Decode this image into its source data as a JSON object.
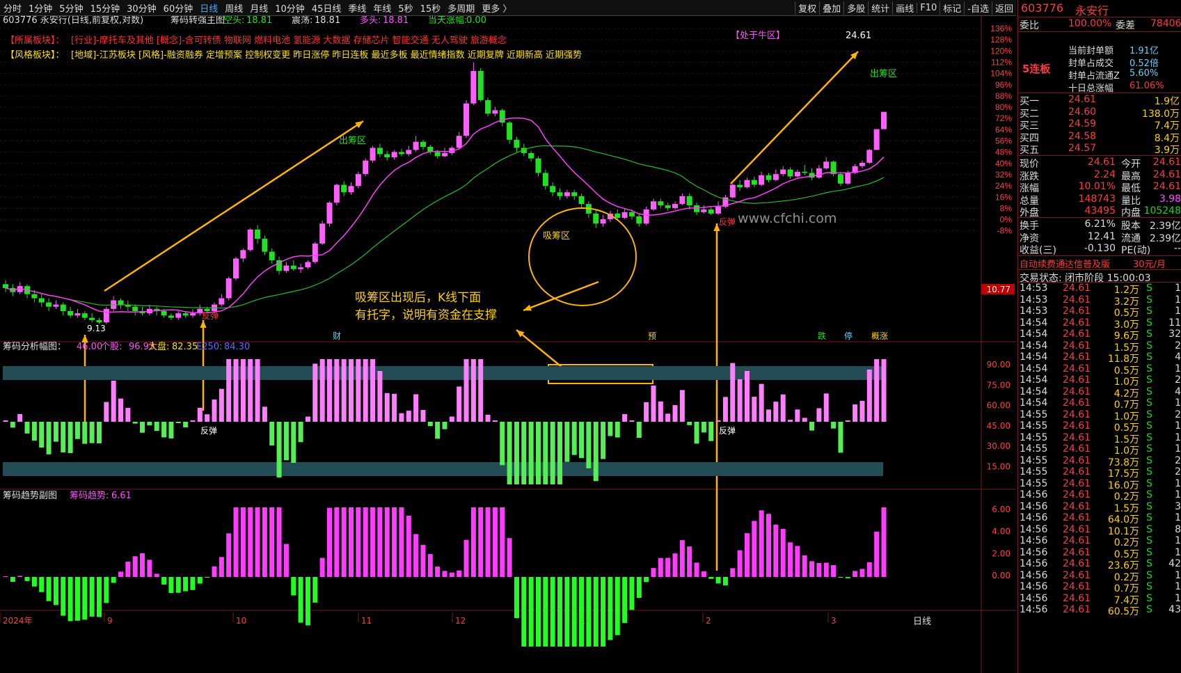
{
  "toolbar": {
    "periods": [
      "分时",
      "1分钟",
      "5分钟",
      "15分钟",
      "30分钟",
      "60分钟",
      "日线",
      "周线",
      "月线",
      "10分钟",
      "45日线",
      "季线",
      "年线",
      "5秒",
      "15秒",
      "多周期",
      "更多 〉"
    ],
    "active": "日线",
    "right": [
      "复权",
      "叠加",
      "多股",
      "统计",
      "画线",
      "F10",
      "标记",
      "-自选",
      "返回"
    ]
  },
  "chart_data": {
    "type": "candlestick",
    "x_labels": [
      "2024年",
      "9",
      "10",
      "11",
      "12",
      "1",
      "2",
      "3"
    ],
    "price_axis": [
      "136%",
      "128%",
      "120%",
      "112%",
      "104%",
      "96%",
      "88%",
      "80%",
      "72%",
      "64%",
      "56%",
      "48%",
      "40%",
      "32%",
      "24%",
      "16%",
      "8%",
      "0%",
      "-8%"
    ],
    "price_axis_tag": "10.77",
    "cost_axis": [
      "90.00",
      "75.00",
      "60.00",
      "45.00",
      "30.00",
      "15.00"
    ],
    "trend_axis": [
      "6.00",
      "4.00",
      "2.00",
      "0.00"
    ],
    "high_label": "24.61",
    "low_label": "9.13",
    "top_info": {
      "code": "603776 永安行(日线,前复权,对数)",
      "indicator": "筹码转强主图",
      "short_label": "空头:",
      "short_val": "18.81",
      "osc_label": "震荡:",
      "osc_val": "18.81",
      "long_label": "多头:",
      "long_val": "18.81",
      "chg_label": "当天涨幅:",
      "chg_val": "0.00"
    },
    "sector1": "【所属板块】：",
    "sector1_text": "[行业]-摩托车及其他 [概念]-含可转债 物联网 燃料电池 氢能源 大数据 存储芯片 智能交通 无人驾驶 旅游概念",
    "sector2": "【风格板块】：",
    "sector2_text": "[地域]-江苏板块 [风格]-融资融券 定增预案 控制权变更 昨日涨停 昨日连板 最近多板 最近情绪指数 近期复牌 近期新高 近期强势",
    "sub1": {
      "name": "筹码分析幅图：",
      "v1": "46.00",
      "v2l": "个股:",
      "v2": "96.93",
      "v3l": "大盘:",
      "v3": "82.35",
      "v4l": "E250:",
      "v4": "84.30"
    },
    "sub2": {
      "name": "筹码趋势副图",
      "v1l": "筹码趋势:",
      "v1": "6.61"
    },
    "annotations": {
      "chu1": "出筹区",
      "chu2": "出筹区",
      "xi": "吸筹区",
      "niu": "【处于牛区】",
      "fan1": "反弹",
      "fan2": "反弹",
      "fan3": "反弹",
      "fan4": "反弹",
      "cai": "财",
      "yu": "预",
      "die": "跌",
      "ting": "停",
      "gai": "概涨",
      "note1": "吸筹区出现后，K线下面",
      "note2": "有托字，说明有资金在支撑",
      "watermark": "www.cfchi.com",
      "bottom": "日线"
    },
    "candles": [
      [
        11.0,
        10.8,
        11.2,
        10.6
      ],
      [
        10.8,
        10.6,
        11.0,
        10.4
      ],
      [
        10.6,
        10.9,
        11.1,
        10.5
      ],
      [
        10.9,
        10.5,
        11.0,
        10.3
      ],
      [
        10.5,
        10.3,
        10.7,
        10.1
      ],
      [
        10.3,
        10.1,
        10.5,
        9.9
      ],
      [
        10.1,
        9.9,
        10.3,
        9.7
      ],
      [
        9.9,
        10.0,
        10.2,
        9.8
      ],
      [
        10.0,
        9.7,
        10.1,
        9.5
      ],
      [
        9.7,
        9.5,
        9.9,
        9.4
      ],
      [
        9.5,
        9.6,
        9.8,
        9.4
      ],
      [
        9.6,
        9.4,
        9.7,
        9.3
      ],
      [
        9.4,
        9.3,
        9.6,
        9.2
      ],
      [
        9.3,
        9.2,
        9.4,
        9.13
      ],
      [
        9.2,
        9.8,
        9.9,
        9.13
      ],
      [
        9.8,
        10.2,
        10.4,
        9.7
      ],
      [
        10.2,
        10.0,
        10.3,
        9.8
      ],
      [
        10.0,
        9.9,
        10.2,
        9.7
      ],
      [
        9.9,
        9.7,
        10.0,
        9.5
      ],
      [
        9.7,
        9.6,
        9.9,
        9.5
      ],
      [
        9.6,
        9.8,
        10.0,
        9.5
      ],
      [
        9.8,
        9.7,
        9.9,
        9.5
      ],
      [
        9.7,
        9.5,
        9.8,
        9.4
      ],
      [
        9.5,
        9.4,
        9.6,
        9.3
      ],
      [
        9.4,
        9.6,
        9.7,
        9.3
      ],
      [
        9.6,
        9.5,
        9.7,
        9.4
      ],
      [
        9.5,
        9.6,
        9.8,
        9.4
      ],
      [
        9.6,
        9.8,
        10.0,
        9.5
      ],
      [
        9.8,
        9.7,
        9.9,
        9.6
      ],
      [
        9.7,
        10.0,
        10.1,
        9.6
      ],
      [
        10.0,
        10.3,
        10.5,
        9.9
      ],
      [
        10.3,
        11.3,
        11.4,
        10.2
      ],
      [
        11.3,
        12.4,
        12.5,
        11.2
      ],
      [
        12.4,
        12.9,
        13.0,
        12.2
      ],
      [
        12.9,
        14.2,
        14.3,
        12.8
      ],
      [
        14.2,
        13.6,
        14.5,
        13.3
      ],
      [
        13.6,
        12.8,
        13.8,
        12.6
      ],
      [
        12.8,
        12.3,
        13.0,
        12.1
      ],
      [
        12.3,
        11.7,
        12.5,
        11.5
      ],
      [
        11.7,
        12.0,
        12.2,
        11.6
      ],
      [
        12.0,
        11.8,
        12.3,
        11.7
      ],
      [
        11.8,
        11.9,
        12.1,
        11.6
      ],
      [
        11.9,
        12.2,
        12.3,
        11.8
      ],
      [
        12.2,
        13.3,
        13.4,
        12.1
      ],
      [
        13.3,
        14.6,
        14.8,
        13.2
      ],
      [
        14.6,
        16.1,
        16.2,
        14.4
      ],
      [
        16.1,
        17.5,
        17.6,
        15.9
      ],
      [
        17.5,
        16.9,
        17.8,
        16.6
      ],
      [
        16.9,
        17.4,
        17.7,
        16.7
      ],
      [
        17.4,
        18.4,
        18.6,
        17.2
      ],
      [
        18.4,
        19.6,
        19.8,
        18.2
      ],
      [
        19.6,
        20.8,
        21.0,
        19.4
      ],
      [
        20.8,
        20.2,
        21.2,
        19.9
      ],
      [
        20.2,
        19.9,
        20.5,
        19.6
      ],
      [
        19.9,
        20.4,
        20.6,
        19.7
      ],
      [
        20.4,
        20.2,
        20.7,
        20.0
      ],
      [
        20.2,
        20.6,
        21.0,
        20.0
      ],
      [
        20.6,
        21.4,
        22.0,
        20.4
      ],
      [
        21.4,
        20.9,
        21.6,
        20.6
      ],
      [
        20.9,
        20.4,
        21.1,
        20.2
      ],
      [
        20.4,
        20.0,
        20.6,
        19.8
      ],
      [
        20.0,
        20.3,
        20.8,
        19.9
      ],
      [
        20.3,
        20.8,
        21.0,
        20.1
      ],
      [
        20.8,
        22.0,
        22.4,
        20.7
      ],
      [
        22.0,
        25.6,
        26.0,
        21.8
      ],
      [
        25.6,
        29.8,
        31.0,
        25.4
      ],
      [
        29.8,
        26.0,
        30.2,
        25.8
      ],
      [
        26.0,
        24.4,
        26.3,
        24.1
      ],
      [
        24.4,
        24.8,
        25.2,
        24.1
      ],
      [
        24.8,
        23.4,
        25.0,
        23.0
      ],
      [
        23.4,
        21.6,
        23.6,
        21.2
      ],
      [
        21.6,
        20.8,
        21.9,
        20.4
      ],
      [
        20.8,
        20.3,
        21.2,
        20.0
      ],
      [
        20.3,
        19.8,
        20.5,
        19.5
      ],
      [
        19.8,
        18.5,
        20.0,
        18.2
      ],
      [
        18.5,
        17.4,
        18.8,
        17.1
      ],
      [
        17.4,
        16.9,
        17.7,
        16.6
      ],
      [
        16.9,
        16.6,
        17.2,
        16.3
      ],
      [
        16.6,
        16.9,
        17.1,
        16.4
      ],
      [
        16.9,
        16.6,
        17.1,
        16.3
      ],
      [
        16.6,
        16.0,
        16.8,
        15.7
      ],
      [
        16.0,
        15.3,
        16.2,
        15.0
      ],
      [
        15.3,
        14.6,
        15.6,
        14.3
      ],
      [
        14.6,
        14.9,
        15.2,
        14.4
      ],
      [
        14.9,
        15.3,
        15.5,
        14.7
      ],
      [
        15.3,
        15.0,
        15.6,
        14.8
      ],
      [
        15.0,
        15.4,
        15.7,
        14.9
      ],
      [
        15.4,
        15.1,
        15.6,
        14.9
      ],
      [
        15.1,
        14.6,
        15.3,
        14.4
      ],
      [
        14.6,
        15.6,
        15.8,
        14.5
      ],
      [
        15.6,
        16.2,
        16.4,
        15.5
      ],
      [
        16.2,
        15.9,
        16.4,
        15.7
      ],
      [
        15.9,
        15.7,
        16.1,
        15.5
      ],
      [
        15.7,
        16.0,
        16.2,
        15.6
      ],
      [
        16.0,
        16.6,
        16.8,
        15.9
      ],
      [
        16.6,
        15.9,
        16.8,
        15.6
      ],
      [
        15.9,
        15.4,
        16.1,
        15.2
      ],
      [
        15.4,
        15.6,
        15.9,
        15.3
      ],
      [
        15.6,
        15.3,
        15.8,
        15.2
      ],
      [
        15.3,
        15.8,
        16.2,
        15.2
      ],
      [
        15.8,
        16.5,
        16.7,
        15.7
      ],
      [
        16.5,
        17.5,
        17.6,
        16.4
      ],
      [
        17.5,
        17.3,
        17.9,
        17.0
      ],
      [
        17.3,
        17.9,
        18.1,
        17.2
      ],
      [
        17.9,
        17.5,
        18.2,
        17.3
      ],
      [
        17.5,
        18.3,
        18.6,
        17.4
      ],
      [
        18.3,
        17.9,
        18.5,
        17.7
      ],
      [
        17.9,
        18.4,
        18.8,
        17.8
      ],
      [
        18.4,
        18.8,
        19.1,
        18.2
      ],
      [
        18.8,
        18.2,
        19.0,
        18.0
      ],
      [
        18.2,
        18.6,
        18.8,
        18.1
      ],
      [
        18.6,
        18.5,
        19.2,
        18.3
      ],
      [
        18.5,
        18.1,
        18.9,
        17.9
      ],
      [
        18.1,
        18.9,
        19.2,
        18.0
      ],
      [
        18.9,
        19.5,
        19.9,
        18.8
      ],
      [
        19.5,
        18.4,
        19.6,
        18.2
      ],
      [
        18.4,
        17.6,
        18.6,
        17.4
      ],
      [
        17.6,
        18.5,
        18.7,
        17.5
      ],
      [
        18.5,
        19.1,
        19.3,
        18.4
      ],
      [
        19.1,
        19.4,
        19.6,
        18.9
      ],
      [
        19.4,
        20.6,
        20.7,
        19.3
      ],
      [
        20.6,
        22.7,
        22.7,
        20.6
      ],
      [
        22.7,
        24.61,
        24.61,
        22.7
      ]
    ]
  },
  "right_panel": {
    "head_code": "603776",
    "head_name": "永安行",
    "weibi_l": "委比",
    "weibi": "100.00%",
    "weicha_l": "委差",
    "weicha": "78406",
    "lianban": "5连板",
    "fengdan": [
      [
        "当前封单额",
        "1.91亿"
      ],
      [
        "封单占成交",
        "0.52倍"
      ],
      [
        "封单占流通Z",
        "5.60%"
      ],
      [
        "十日总涨幅",
        "61.06%"
      ]
    ],
    "bids": [
      [
        "买一",
        "24.61",
        "1.9亿"
      ],
      [
        "买二",
        "24.60",
        "138.0万"
      ],
      [
        "买三",
        "24.59",
        "7.4万"
      ],
      [
        "买四",
        "24.58",
        "8.4万"
      ],
      [
        "买五",
        "24.57",
        "3.9万"
      ]
    ],
    "quote": [
      [
        "现价",
        "24.61",
        "今开",
        "24.61"
      ],
      [
        "涨跌",
        "2.24",
        "最高",
        "24.61"
      ],
      [
        "涨幅",
        "10.01%",
        "最低",
        "24.61"
      ],
      [
        "总量",
        "148743",
        "量比",
        "3.98"
      ],
      [
        "外盘",
        "43495",
        "内盘",
        "105248"
      ]
    ],
    "fin": [
      [
        "换手",
        "6.21%",
        "股本",
        "2.39亿"
      ],
      [
        "净资",
        "12.41",
        "流通",
        "2.39亿"
      ],
      [
        "收益(三)",
        "-0.130",
        "PE(动)",
        "--"
      ]
    ],
    "ad": "自动续费通达信普及版",
    "ad_price": "30元/月",
    "state": "交易状态: 闭市阶段 15:00:03",
    "ticks": [
      [
        "14:53",
        "24.61",
        "1.2万",
        "S",
        "1"
      ],
      [
        "14:53",
        "24.61",
        "3.2万",
        "S",
        "1"
      ],
      [
        "14:53",
        "24.61",
        "0.5万",
        "S",
        "1"
      ],
      [
        "14:54",
        "24.61",
        "3.0万",
        "S",
        "11"
      ],
      [
        "14:54",
        "24.61",
        "9.6万",
        "S",
        "32"
      ],
      [
        "14:54",
        "24.61",
        "1.5万",
        "S",
        "2"
      ],
      [
        "14:54",
        "24.61",
        "11.8万",
        "S",
        "4"
      ],
      [
        "14:54",
        "24.61",
        "0.5万",
        "S",
        "1"
      ],
      [
        "14:54",
        "24.61",
        "1.0万",
        "S",
        "2"
      ],
      [
        "14:54",
        "24.61",
        "4.2万",
        "S",
        "4"
      ],
      [
        "14:54",
        "24.61",
        "0.7万",
        "S",
        "1"
      ],
      [
        "14:55",
        "24.61",
        "1.0万",
        "S",
        "2"
      ],
      [
        "14:55",
        "24.61",
        "0.5万",
        "S",
        "1"
      ],
      [
        "14:55",
        "24.61",
        "1.5万",
        "S",
        "1"
      ],
      [
        "14:55",
        "24.61",
        "1.0万",
        "S",
        "1"
      ],
      [
        "14:55",
        "24.61",
        "73.8万",
        "S",
        "2"
      ],
      [
        "14:55",
        "24.61",
        "17.5万",
        "S",
        "2"
      ],
      [
        "14:55",
        "24.61",
        "16.0万",
        "S",
        "1"
      ],
      [
        "14:56",
        "24.61",
        "0.2万",
        "S",
        "1"
      ],
      [
        "14:56",
        "24.61",
        "1.5万",
        "S",
        "3"
      ],
      [
        "14:56",
        "24.61",
        "64.0万",
        "S",
        "1"
      ],
      [
        "14:56",
        "24.61",
        "10.1万",
        "S",
        "8"
      ],
      [
        "14:56",
        "24.61",
        "0.2万",
        "S",
        "1"
      ],
      [
        "14:56",
        "24.61",
        "0.5万",
        "S",
        "1"
      ],
      [
        "14:56",
        "24.61",
        "23.6万",
        "S",
        "42"
      ],
      [
        "14:56",
        "24.61",
        "0.2万",
        "S",
        "1"
      ],
      [
        "14:56",
        "24.61",
        "0.7万",
        "S",
        "1"
      ],
      [
        "14:56",
        "24.61",
        "7.4万",
        "S",
        "1"
      ],
      [
        "14:56",
        "24.61",
        "60.5万",
        "S",
        "43"
      ]
    ]
  }
}
